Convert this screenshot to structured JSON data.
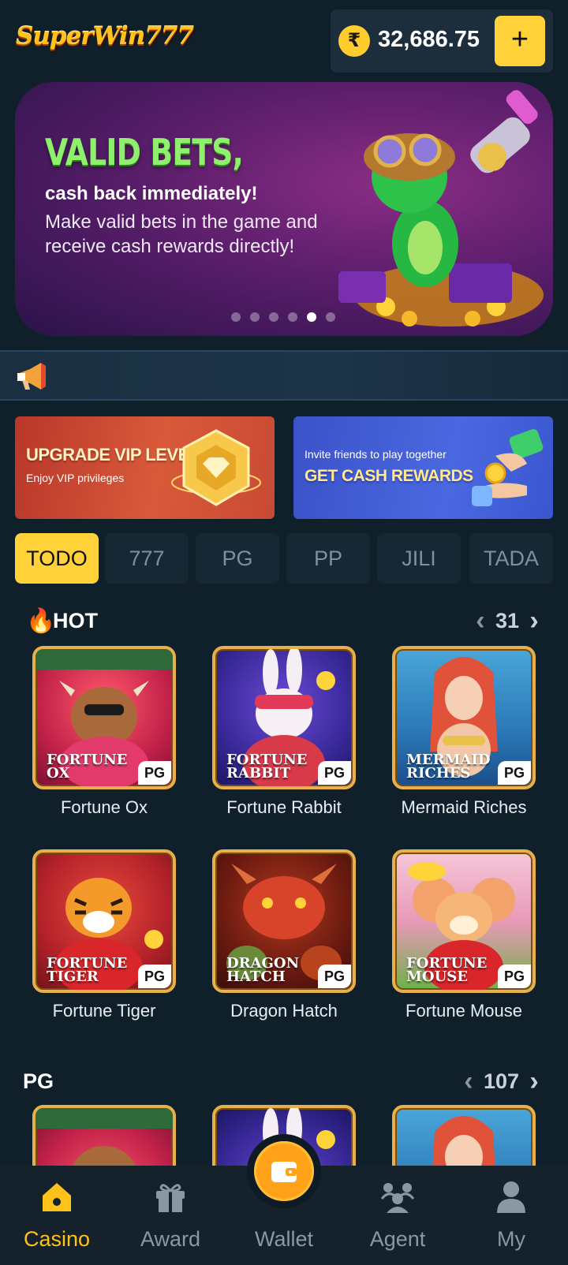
{
  "header": {
    "logo_text": "SuperWin777",
    "currency_symbol": "₹",
    "balance": "32,686.75",
    "add_label": "+"
  },
  "banner": {
    "title": "VALID BETS,",
    "subtitle": "cash back immediately!",
    "body": "Make valid bets in the game and receive cash rewards directly!",
    "dots_total": 6,
    "active_dot": 5
  },
  "promos": {
    "vip": {
      "title": "UPGRADE VIP LEVEL",
      "subtitle": "Enjoy VIP privileges"
    },
    "invite": {
      "title": "GET CASH REWARDS",
      "subtitle": "Invite friends to play together"
    }
  },
  "tabs": [
    "TODO",
    "777",
    "PG",
    "PP",
    "JILI",
    "TADA"
  ],
  "active_tab": 0,
  "sections": {
    "hot": {
      "title": "HOT",
      "count": "31",
      "games": [
        {
          "label": "Fortune Ox",
          "thumb_line1": "Fortune",
          "thumb_line2": "Ox",
          "provider": "PG"
        },
        {
          "label": "Fortune Rabbit",
          "thumb_line1": "Fortune",
          "thumb_line2": "Rabbit",
          "provider": "PG"
        },
        {
          "label": "Mermaid Riches",
          "thumb_line1": "Mermaid",
          "thumb_line2": "Riches",
          "provider": "PG"
        },
        {
          "label": "Fortune Tiger",
          "thumb_line1": "Fortune",
          "thumb_line2": "Tiger",
          "provider": "PG"
        },
        {
          "label": "Dragon Hatch",
          "thumb_line1": "Dragon",
          "thumb_line2": "Hatch",
          "provider": "PG"
        },
        {
          "label": "Fortune Mouse",
          "thumb_line1": "Fortune",
          "thumb_line2": "Mouse",
          "provider": "PG"
        }
      ]
    },
    "pg": {
      "title": "PG",
      "count": "107"
    }
  },
  "bottom_nav": [
    {
      "label": "Casino",
      "icon": "home-icon",
      "active": true
    },
    {
      "label": "Award",
      "icon": "gift-icon",
      "active": false
    },
    {
      "label": "Wallet",
      "icon": "wallet-icon",
      "active": false
    },
    {
      "label": "Agent",
      "icon": "agent-icon",
      "active": false
    },
    {
      "label": "My",
      "icon": "user-icon",
      "active": false
    }
  ],
  "colors": {
    "background": "#10202b",
    "accent_yellow": "#ffd23a",
    "active_nav": "#ffc21a",
    "card_border": "#e8b04a"
  }
}
